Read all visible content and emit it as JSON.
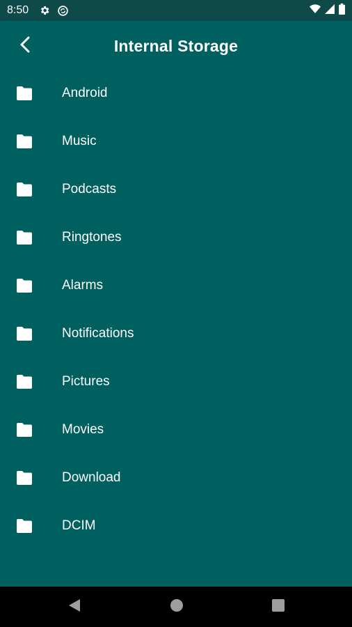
{
  "status_bar": {
    "time": "8:50",
    "left_icons": [
      "gear-icon",
      "sync-icon"
    ],
    "right_icons": [
      "wifi-icon",
      "signal-icon",
      "battery-icon"
    ]
  },
  "app_bar": {
    "title": "Internal Storage",
    "back_icon": "back-arrow-icon"
  },
  "folders": [
    {
      "label": "Android",
      "icon": "folder-icon"
    },
    {
      "label": "Music",
      "icon": "folder-icon"
    },
    {
      "label": "Podcasts",
      "icon": "folder-icon"
    },
    {
      "label": "Ringtones",
      "icon": "folder-icon"
    },
    {
      "label": "Alarms",
      "icon": "folder-icon"
    },
    {
      "label": "Notifications",
      "icon": "folder-icon"
    },
    {
      "label": "Pictures",
      "icon": "folder-icon"
    },
    {
      "label": "Movies",
      "icon": "folder-icon"
    },
    {
      "label": "Download",
      "icon": "folder-icon"
    },
    {
      "label": "DCIM",
      "icon": "folder-icon"
    }
  ],
  "nav_bar": {
    "icons": [
      "back-triangle-icon",
      "home-circle-icon",
      "recents-square-icon"
    ]
  },
  "colors": {
    "background": "#005f5f",
    "status_bar": "#0d4a49",
    "nav_bar": "#000000",
    "foreground": "#ffffff"
  }
}
